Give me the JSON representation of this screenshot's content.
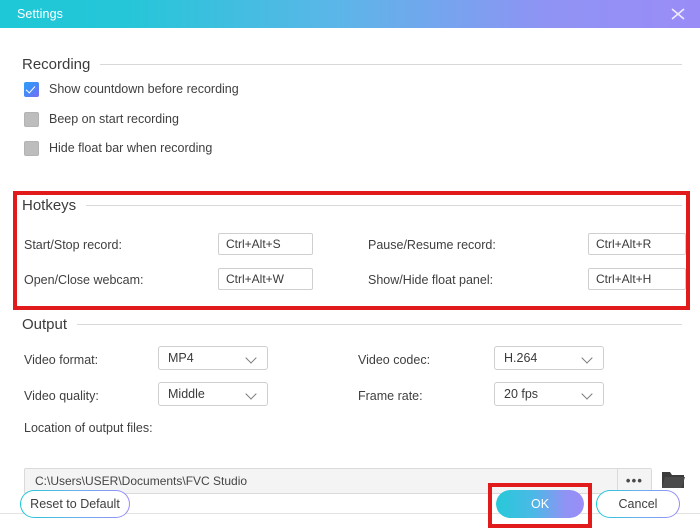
{
  "window": {
    "title": "Settings",
    "close_icon": "close-icon"
  },
  "sections": {
    "recording": {
      "title": "Recording",
      "checkboxes": [
        {
          "label": "Show countdown before recording",
          "checked": true
        },
        {
          "label": "Beep on start recording",
          "checked": false
        },
        {
          "label": "Hide float bar when recording",
          "checked": false
        }
      ]
    },
    "hotkeys": {
      "title": "Hotkeys",
      "fields": [
        {
          "label": "Start/Stop record:",
          "value": "Ctrl+Alt+S"
        },
        {
          "label": "Pause/Resume record:",
          "value": "Ctrl+Alt+R"
        },
        {
          "label": "Open/Close webcam:",
          "value": "Ctrl+Alt+W"
        },
        {
          "label": "Show/Hide float panel:",
          "value": "Ctrl+Alt+H"
        }
      ]
    },
    "output": {
      "title": "Output",
      "dropdowns": [
        {
          "label": "Video format:",
          "value": "MP4"
        },
        {
          "label": "Video codec:",
          "value": "H.264"
        },
        {
          "label": "Video quality:",
          "value": "Middle"
        },
        {
          "label": "Frame rate:",
          "value": "20 fps"
        }
      ],
      "location_label": "Location of output files:",
      "location_path": "C:\\Users\\USER\\Documents\\FVC Studio",
      "browse_dots": "•••",
      "folder_icon": "folder-icon"
    }
  },
  "footer": {
    "reset_label": "Reset to Default",
    "ok_label": "OK",
    "cancel_label": "Cancel"
  },
  "annotations": {
    "highlight_color": "#e11b1b",
    "boxes": [
      "hotkeys-section",
      "ok-button"
    ]
  },
  "colors": {
    "titlebar_gradient_start": "#1ec8d6",
    "titlebar_gradient_end": "#9a8cf7",
    "checkbox_checked": "#3f8ef7",
    "annotation_red": "#e11b1b"
  }
}
